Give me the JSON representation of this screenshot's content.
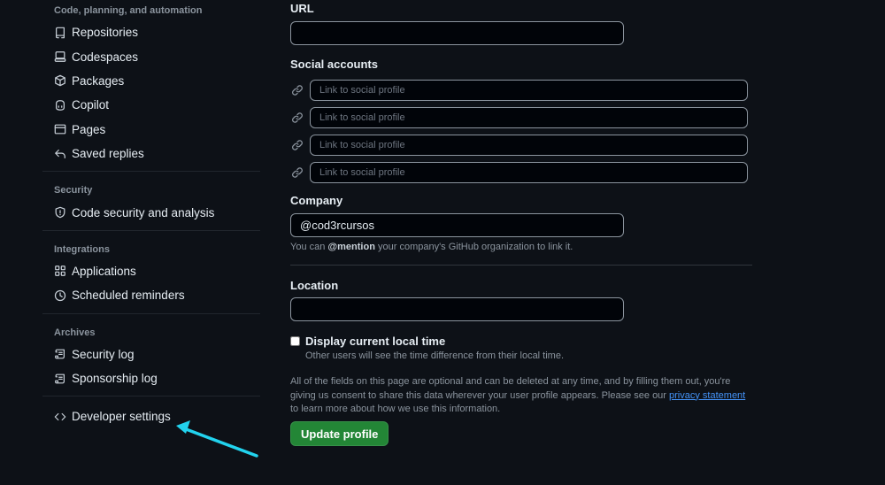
{
  "sidebar": {
    "group_code": {
      "title": "Code, planning, and automation",
      "items": [
        "Repositories",
        "Codespaces",
        "Packages",
        "Copilot",
        "Pages",
        "Saved replies"
      ]
    },
    "group_security": {
      "title": "Security",
      "items": [
        "Code security and analysis"
      ]
    },
    "group_integrations": {
      "title": "Integrations",
      "items": [
        "Applications",
        "Scheduled reminders"
      ]
    },
    "group_archives": {
      "title": "Archives",
      "items": [
        "Security log",
        "Sponsorship log"
      ]
    },
    "developer_settings": "Developer settings"
  },
  "form": {
    "url_label": "URL",
    "url_value": "",
    "social_label": "Social accounts",
    "social_placeholder": "Link to social profile",
    "company_label": "Company",
    "company_value": "@cod3rcursos",
    "company_note_prefix": "You can ",
    "company_note_mention": "@mention",
    "company_note_suffix": " your company's GitHub organization to link it.",
    "location_label": "Location",
    "location_value": "",
    "local_time_label": "Display current local time",
    "local_time_checked": false,
    "local_time_note": "Other users will see the time difference from their local time.",
    "disclaimer_text": "All of the fields on this page are optional and can be deleted at any time, and by filling them out, you're giving us consent to share this data wherever your user profile appears. Please see our ",
    "privacy_link": "privacy statement",
    "disclaimer_suffix": " to learn more about how we use this information.",
    "update_button": "Update profile"
  },
  "colors": {
    "background": "#0d1117",
    "accent_button": "#238636",
    "link": "#4493f8",
    "annotation_arrow": "#22d3ee"
  }
}
